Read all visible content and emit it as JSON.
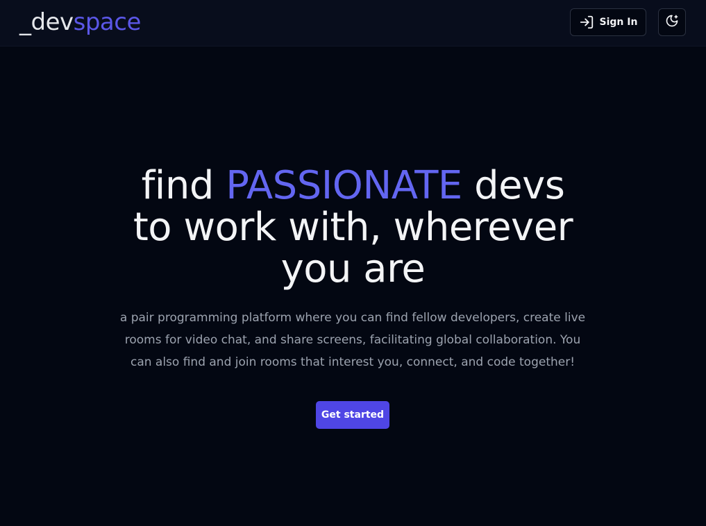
{
  "header": {
    "logo_prefix": "_dev",
    "logo_accent": "space",
    "signin_label": "Sign In",
    "signin_icon": "sign-in-icon",
    "theme_icon": "moon-stars-icon"
  },
  "hero": {
    "title_part1": "find ",
    "title_accent": "PASSIONATE",
    "title_part2": " devs",
    "title_line2": "to work with, wherever",
    "title_line3": "you are",
    "subtitle": "a pair programming platform where you can find fellow developers, create live rooms for video chat, and share screens, facilitating global collaboration. You can also find and join rooms that interest you, connect, and code together!",
    "cta_label": "Get started"
  },
  "colors": {
    "background": "#030712",
    "header_background": "#080d1c",
    "accent": "#6366f1",
    "button": "#4f46e5",
    "text": "#f3f4f6",
    "muted_text": "#9ca3af"
  }
}
